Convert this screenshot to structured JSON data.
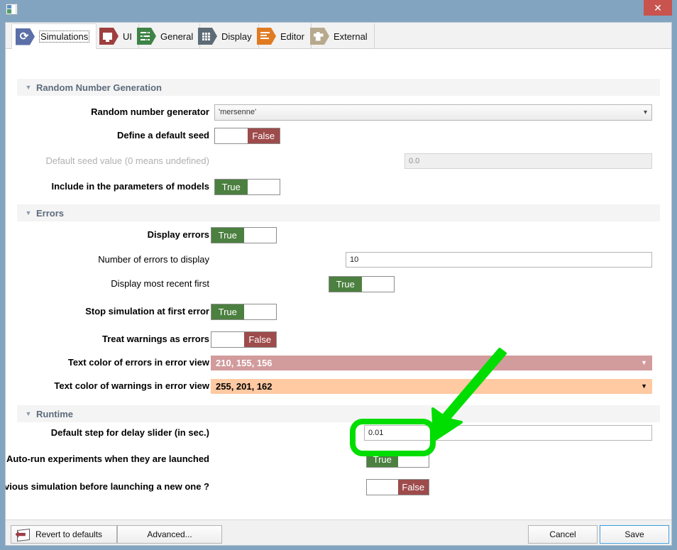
{
  "window": {
    "app_icon": "app-window-icon",
    "close_label": "✕"
  },
  "tabs": [
    {
      "label": "Simulations",
      "icon": "refresh-icon",
      "color": "#5b6fa8",
      "active": true
    },
    {
      "label": "UI",
      "icon": "monitor-icon",
      "color": "#9e3f3f",
      "active": false
    },
    {
      "label": "General",
      "icon": "sliders-icon",
      "color": "#3f8347",
      "active": false
    },
    {
      "label": "Display",
      "icon": "grid-icon",
      "color": "#5d6b76",
      "active": false
    },
    {
      "label": "Editor",
      "icon": "lines-icon",
      "color": "#e07b22",
      "active": false
    },
    {
      "label": "External",
      "icon": "puzzle-icon",
      "color": "#b7a98e",
      "active": false
    }
  ],
  "sections": {
    "rng": {
      "title": "Random Number Generation",
      "generator_label": "Random number generator",
      "generator_value": "'mersenne'",
      "seed_label": "Define a default seed",
      "seed_value": "False",
      "seed_value_label": "Default seed value (0 means undefined)",
      "seed_value_field": "0.0",
      "include_label": "Include in the parameters of models",
      "include_value": "True"
    },
    "errors": {
      "title": "Errors",
      "display_errors_label": "Display errors",
      "display_errors_value": "True",
      "number_label": "Number of errors to display",
      "number_value": "10",
      "recent_label": "Display most recent first",
      "recent_value": "True",
      "stop_label": "Stop simulation at first error",
      "stop_value": "True",
      "warnings_label": "Treat warnings as errors",
      "warnings_value": "False",
      "error_color_label": "Text color of errors in error view",
      "error_color_value": "210, 155, 156",
      "error_color_hex": "#d29b9c",
      "error_color_text": "#ffffff",
      "warning_color_label": "Text color of warnings in error view",
      "warning_color_value": "255, 201, 162",
      "warning_color_hex": "#ffc9a2",
      "warning_color_text": "#000000"
    },
    "runtime": {
      "title": "Runtime",
      "step_label": "Default step for delay slider (in sec.)",
      "step_value": "0.01",
      "autorun_label": "Auto-run experiments when they are launched",
      "autorun_value": "True",
      "askclose_label": "Ask to close the previous simulation before launching a new one ?",
      "askclose_value": "False"
    }
  },
  "footer": {
    "revert_label": "Revert to defaults",
    "advanced_label": "Advanced...",
    "cancel_label": "Cancel",
    "save_label": "Save"
  },
  "toggle_labels": {
    "true": "True",
    "false": "False"
  },
  "annotation": {
    "highlight_color": "#00dd00",
    "arrow_color": "#00dd00"
  },
  "colors": {
    "true_green": "#4c8040",
    "false_red": "#9e4b4b",
    "titlebar": "#82a4c0",
    "close": "#c9544f"
  }
}
